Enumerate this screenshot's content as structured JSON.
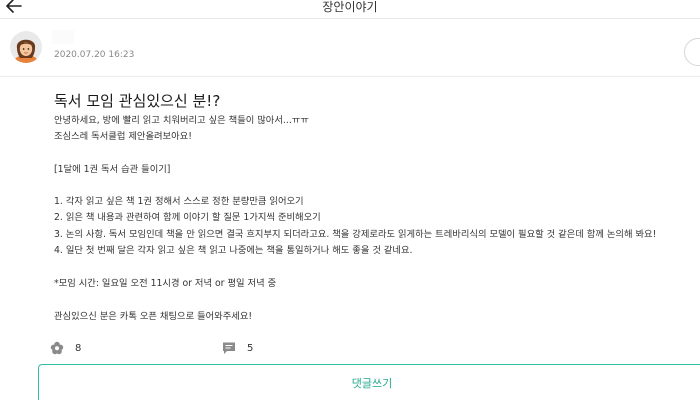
{
  "header": {
    "title": "장안이야기",
    "back_icon": "arrow-left-icon"
  },
  "author": {
    "date": "2020.07.20 16:23"
  },
  "post": {
    "title": "독서 모임 관심있으신 분!?",
    "lines": [
      "안녕하세요, 방에 빨리 읽고 치워버리고 싶은 책들이 많아서...ㅠㅠ",
      "조심스레 독서클럽 제안올려보아요!",
      "",
      "[1달에 1권 독서 습관 들이기]",
      "",
      "1. 각자 읽고 싶은 책 1권 정해서 스스로 정한 분량만큼 읽어오기",
      "2. 읽은 책 내용과 관련하여 함께 이야기 할 질문 1가지씩 준비해오기",
      "3. 논의 사항. 독서 모임인데 책을 안 읽으면 결국 흐지부지 되더라고요. 책을 강제로라도 읽게하는 트레바리식의 모델이 필요할 것 같은데 함께 논의해 봐요!",
      "4. 일단 첫 번째 달은 각자 읽고 싶은 책 읽고 나중에는 책을 통일하거나 해도 좋을 것 같네요.",
      "",
      "*모임 시간: 일요일 오전 11시경 or 저녁 or 평일 저녁 중",
      "",
      "관심있으신 분은 카톡 오픈 채팅으로 들어와주세요!"
    ]
  },
  "reactions": {
    "likes": "8",
    "like_icon": "flower-icon",
    "comments": "5",
    "comment_icon": "speech-bubble-icon"
  },
  "comment_button": {
    "label": "댓글쓰기"
  },
  "colors": {
    "accent": "#2fc0a8",
    "accent_text": "#20a88f",
    "icon_gray": "#8a8a8a"
  }
}
